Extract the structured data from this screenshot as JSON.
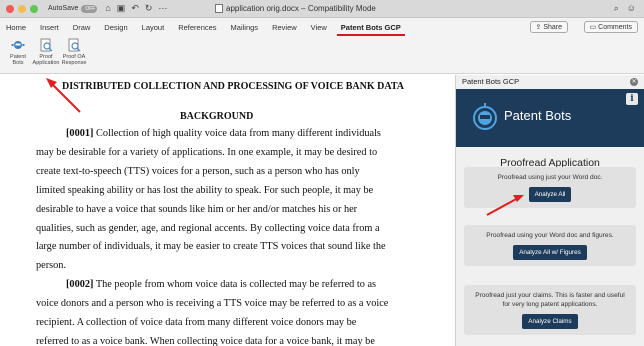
{
  "titlebar": {
    "autosave_label": "AutoSave",
    "autosave_state": "OFF",
    "doc_title": "application orig.docx  –  Compatibility Mode"
  },
  "tabs": [
    "Home",
    "Insert",
    "Draw",
    "Design",
    "Layout",
    "References",
    "Mailings",
    "Review",
    "View",
    "Patent Bots GCP"
  ],
  "active_tab": "Patent Bots GCP",
  "share_label": "Share",
  "comments_label": "Comments",
  "ribbon": {
    "buttons": [
      {
        "label": "Patent Bots",
        "icon": "robot-icon"
      },
      {
        "label": "Proof Application",
        "icon": "magnify-document-icon"
      },
      {
        "label": "Proof OA Response",
        "icon": "magnify-document-icon"
      }
    ]
  },
  "document": {
    "title": "DISTRIBUTED COLLECTION AND PROCESSING OF VOICE BANK DATA",
    "section": "BACKGROUND",
    "lines": [
      {
        "num": "[0001]",
        "text": " Collection of high quality voice data from many different individuals",
        "indent": true
      },
      {
        "text": "may be desirable for a variety of applications.  In one example, it may be desired to"
      },
      {
        "text": "create text-to-speech (TTS) voices for a person, such as a person who has only"
      },
      {
        "text": "limited speaking ability or has lost the ability to speak.  For such people, it may be"
      },
      {
        "text": "desirable to have a voice that sounds like him or her and/or matches his or her"
      },
      {
        "text": "qualities, such as gender, age, and regional accents.  By collecting voice data from a"
      },
      {
        "text": "large number of individuals, it may be easier to create TTS voices that sound like the"
      },
      {
        "text": "person."
      },
      {
        "num": "[0002]",
        "text": " The people from whom voice data is collected may be referred to as",
        "indent": true
      },
      {
        "text": "voice donors and a person who is receiving a TTS voice may be referred to as a voice"
      },
      {
        "text": "recipient.  A collection of voice data from many different voice donors may be"
      },
      {
        "text": "referred to as a voice bank.  When collecting voice data for a voice bank, it may be"
      }
    ]
  },
  "panel": {
    "header": "Patent Bots GCP",
    "brand": "Patent Bots",
    "info_label": "i",
    "title": "Proofread Application",
    "cards": [
      {
        "text": "Proofread using just your Word doc.",
        "button": "Analyze All"
      },
      {
        "text": "Proofread using your Word doc and figures.",
        "button": "Analyze All w/ Figures"
      },
      {
        "text": "Proofread just your claims. This is faster and useful for very long patent applications.",
        "button": "Analyze Claims"
      }
    ]
  },
  "colors": {
    "accent_red": "#d01c1c",
    "brand_navy": "#1d3c5c"
  }
}
